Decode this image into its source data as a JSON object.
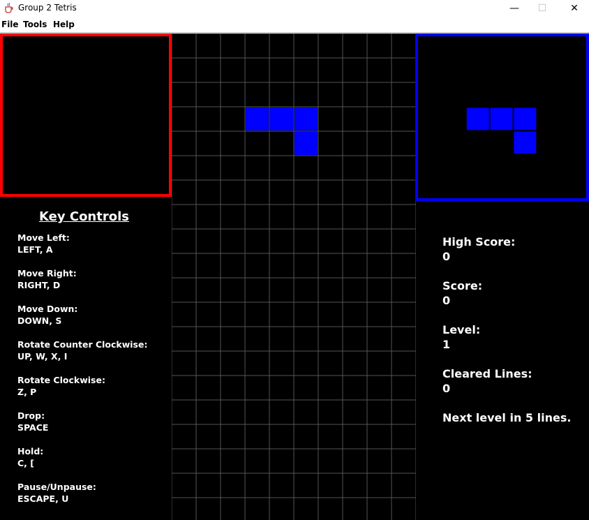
{
  "window": {
    "title": "Group 2 Tetris",
    "icon": "java-cup-icon",
    "minimize": "—",
    "maximize": "☐",
    "close": "✕"
  },
  "menu": [
    "File",
    "Tools",
    "Help"
  ],
  "colors": {
    "hold_border": "#ff0000",
    "next_border": "#0000ff",
    "piece": "#0000ff",
    "grid": "#555555",
    "background": "#000000"
  },
  "board": {
    "columns": 10,
    "rows": 20,
    "active_piece": {
      "shape": "J",
      "cells": [
        [
          3,
          3
        ],
        [
          4,
          3
        ],
        [
          5,
          3
        ],
        [
          5,
          4
        ]
      ]
    }
  },
  "next_piece": {
    "shape": "J"
  },
  "key_controls": {
    "title": "Key Controls",
    "items": [
      {
        "action": "Move Left:",
        "keys": "LEFT, A"
      },
      {
        "action": "Move Right:",
        "keys": "RIGHT, D"
      },
      {
        "action": "Move Down:",
        "keys": "DOWN, S"
      },
      {
        "action": "Rotate Counter Clockwise:",
        "keys": "UP, W, X, I"
      },
      {
        "action": "Rotate Clockwise:",
        "keys": "Z, P"
      },
      {
        "action": "Drop:",
        "keys": "SPACE"
      },
      {
        "action": "Hold:",
        "keys": "C, ["
      },
      {
        "action": "Pause/Unpause:",
        "keys": "ESCAPE, U"
      }
    ]
  },
  "stats": {
    "high_score_label": "High Score:",
    "high_score": "0",
    "score_label": "Score:",
    "score": "0",
    "level_label": "Level:",
    "level": "1",
    "cleared_label": "Cleared Lines:",
    "cleared": "0",
    "next_level_text": "Next level in 5 lines."
  }
}
